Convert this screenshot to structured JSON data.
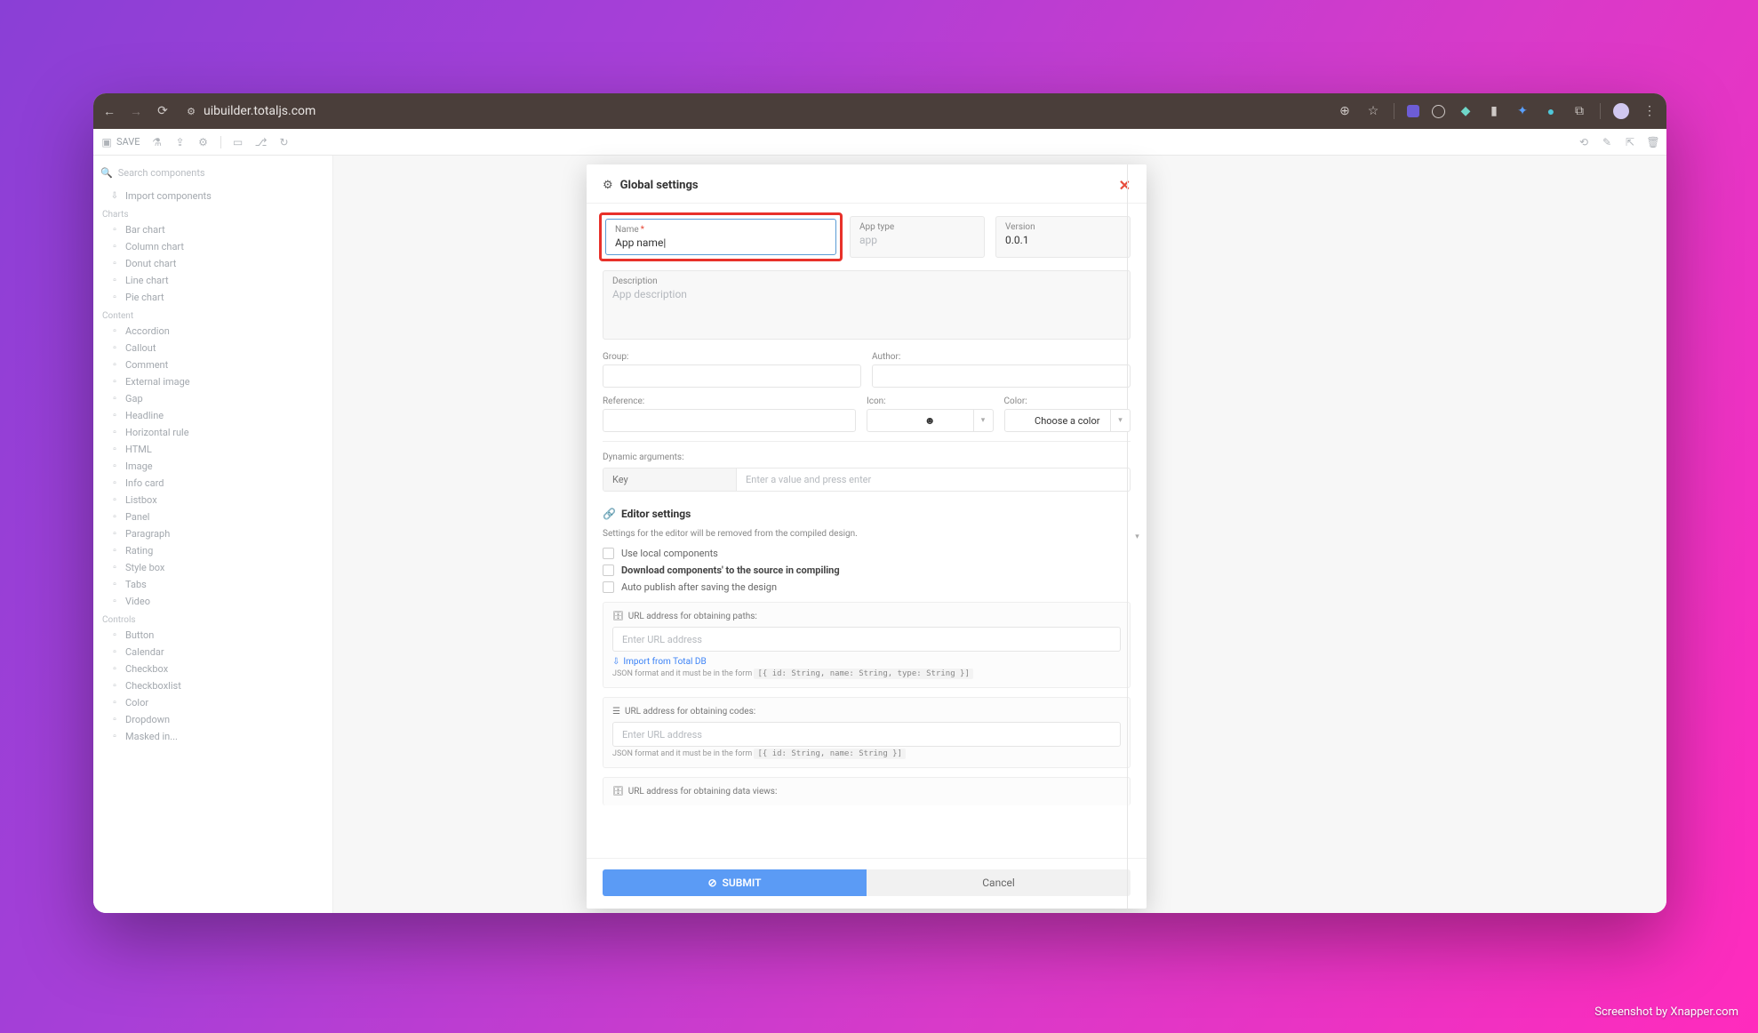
{
  "browser": {
    "url": "uibuilder.totaljs.com"
  },
  "topbar": {
    "save": "SAVE"
  },
  "sidebar": {
    "search_placeholder": "Search components",
    "import": "Import components",
    "groups": [
      {
        "title": "Charts",
        "items": [
          "Bar chart",
          "Column chart",
          "Donut chart",
          "Line chart",
          "Pie chart"
        ]
      },
      {
        "title": "Content",
        "items": [
          "Accordion",
          "Callout",
          "Comment",
          "External image",
          "Gap",
          "Headline",
          "Horizontal rule",
          "HTML",
          "Image",
          "Info card",
          "Listbox",
          "Panel",
          "Paragraph",
          "Rating",
          "Style box",
          "Tabs",
          "Video"
        ]
      },
      {
        "title": "Controls",
        "items": [
          "Button",
          "Calendar",
          "Checkbox",
          "Checkboxlist",
          "Color",
          "Dropdown",
          "Masked in..."
        ]
      }
    ]
  },
  "modal": {
    "title": "Global settings",
    "name": {
      "label": "Name",
      "value": "App name|"
    },
    "apptype": {
      "label": "App type",
      "value": "app"
    },
    "version": {
      "label": "Version",
      "value": "0.0.1"
    },
    "description": {
      "label": "Description",
      "placeholder": "App description"
    },
    "group_label": "Group:",
    "author_label": "Author:",
    "reference_label": "Reference:",
    "icon_label": "Icon:",
    "color_label": "Color:",
    "color_placeholder": "Choose a color",
    "dynargs_label": "Dynamic arguments:",
    "dynargs_key": "Key",
    "dynargs_placeholder": "Enter a value and press enter",
    "editor_title": "Editor settings",
    "editor_note": "Settings for the editor will be removed from the compiled design.",
    "chk1": "Use local components",
    "chk2": "Download components' to the source in compiling",
    "chk3": "Auto publish after saving the design",
    "url_paths_label": "URL address for obtaining paths:",
    "url_placeholder": "Enter URL address",
    "import_totaldb": "Import from Total DB",
    "json_hint_prefix": "JSON format and it must be in the form",
    "json_hint_paths": "[{ id: String, name: String, type: String }]",
    "url_codes_label": "URL address for obtaining codes:",
    "json_hint_codes": "[{ id: String, name: String }]",
    "url_views_label": "URL address for obtaining data views:",
    "submit": "SUBMIT",
    "cancel": "Cancel"
  },
  "footer": {
    "snapper": "Screenshot by Xnapper.com"
  }
}
